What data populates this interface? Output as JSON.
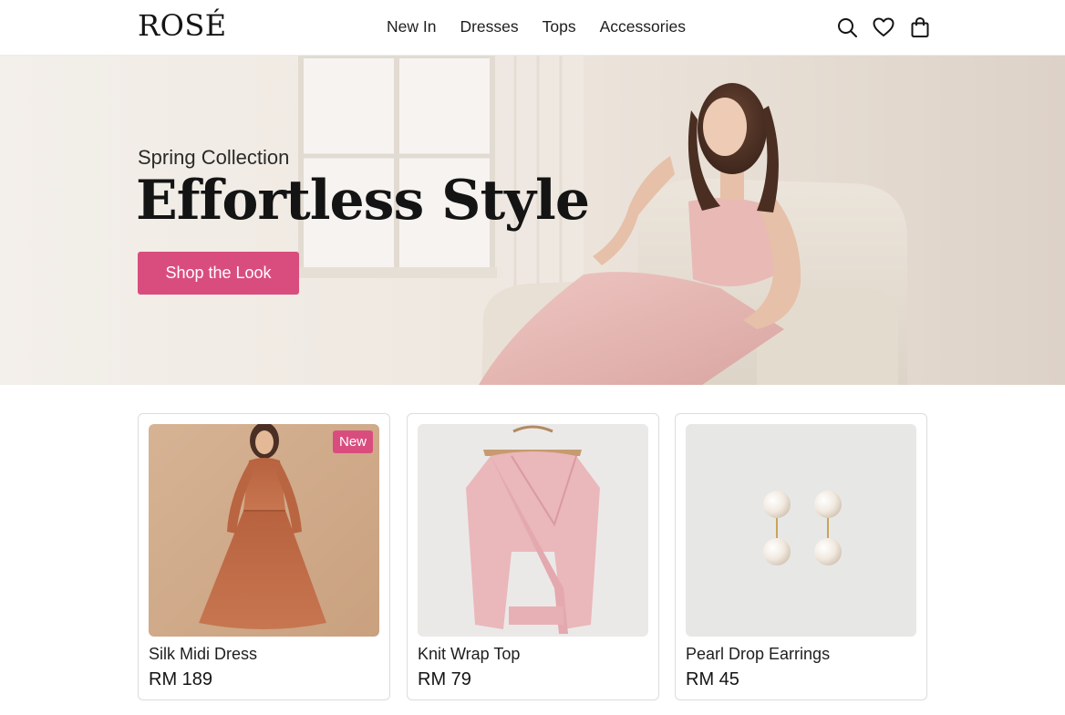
{
  "header": {
    "logo": "ROSÉ",
    "nav": [
      "New In",
      "Dresses",
      "Tops",
      "Accessories"
    ],
    "icons": [
      "search-icon",
      "heart-icon",
      "shopping-bag-icon"
    ]
  },
  "hero": {
    "subtitle": "Spring Collection",
    "title": "Effortless Style",
    "cta": "Shop the Look"
  },
  "products": [
    {
      "name": "Silk Midi Dress",
      "price": "RM 189",
      "badge": "New"
    },
    {
      "name": "Knit Wrap Top",
      "price": "RM 79"
    },
    {
      "name": "Pearl Drop Earrings",
      "price": "RM 45"
    }
  ],
  "colors": {
    "accent": "#d94d7e",
    "text": "#1a1a1a",
    "hero_bg": "#ece5dc"
  }
}
